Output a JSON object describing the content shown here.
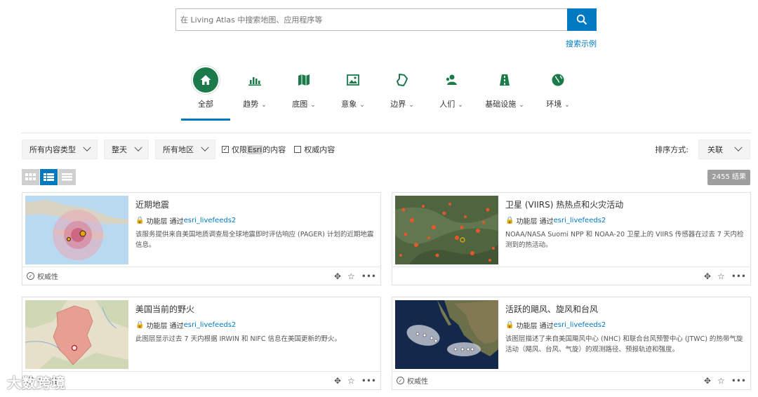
{
  "search": {
    "placeholder": "在 Living Atlas 中搜索地图、应用程序等",
    "button_icon": "search-icon",
    "examples_link": "搜索示例"
  },
  "categories": [
    {
      "label": "全部",
      "icon": "home-icon",
      "active": true,
      "has_dropdown": false
    },
    {
      "label": "趋势",
      "icon": "bar-chart-icon",
      "has_dropdown": true
    },
    {
      "label": "底图",
      "icon": "map-icon",
      "has_dropdown": true
    },
    {
      "label": "意象",
      "icon": "image-icon",
      "has_dropdown": true
    },
    {
      "label": "边界",
      "icon": "boundary-icon",
      "has_dropdown": true
    },
    {
      "label": "人们",
      "icon": "people-icon",
      "has_dropdown": true
    },
    {
      "label": "基础设施",
      "icon": "road-icon",
      "has_dropdown": true
    },
    {
      "label": "环境",
      "icon": "globe-icon",
      "has_dropdown": true
    }
  ],
  "filters": {
    "content_type": "所有内容类型",
    "date": "整天",
    "region": "所有地区",
    "esri_only_prefix": "仅限",
    "esri_only_word": "Esri",
    "esri_only_suffix": "的内容",
    "esri_only_checked": true,
    "authoritative": "权威内容",
    "authoritative_checked": false
  },
  "sort": {
    "label": "排序方式:",
    "value": "关联"
  },
  "results": {
    "count_label": "2455 结果"
  },
  "cards": [
    {
      "title": "近期地震",
      "type": "功能层",
      "via": "通过",
      "owner": "esri_livefeeds2",
      "description": "该服务提供来自美国地质调查局全球地震即时评估响应 (PAGER) 计划的近期地震信息。",
      "authoritative": "权威性",
      "thumb": "earthquake"
    },
    {
      "title": "卫星 (VIIRS) 热热点和火灾活动",
      "type": "功能层",
      "via": "通过",
      "owner": "esri_livefeeds2",
      "description": "NOAA/NASA Suomi NPP 和 NOAA-20 卫星上的 VIIRS 传感器在过去 7 天内检测到的热活动。",
      "authoritative": "",
      "thumb": "fires"
    },
    {
      "title": "美国当前的野火",
      "type": "功能层",
      "via": "通过",
      "owner": "esri_livefeeds2",
      "description": "此图层显示过去 7 天内根据 IRWIN 和 NIFC 信息在美国更新的野火。",
      "authoritative": "权威性",
      "thumb": "wildfire"
    },
    {
      "title": "活跃的飓风、旋风和台风",
      "type": "功能层",
      "via": "通过",
      "owner": "esri_livefeeds2",
      "description": "该图层描述了来自美国飓风中心 (NHC) 和联合台风预警中心 (JTWC) 的热带气旋活动（飓风、台风、气旋）的观测路径、预报轨迹和强度。",
      "authoritative": "权威性",
      "thumb": "hurricane"
    }
  ],
  "watermark": "大数跨境",
  "colors": {
    "accent": "#0079c1",
    "category_green": "#1b7a4a"
  }
}
